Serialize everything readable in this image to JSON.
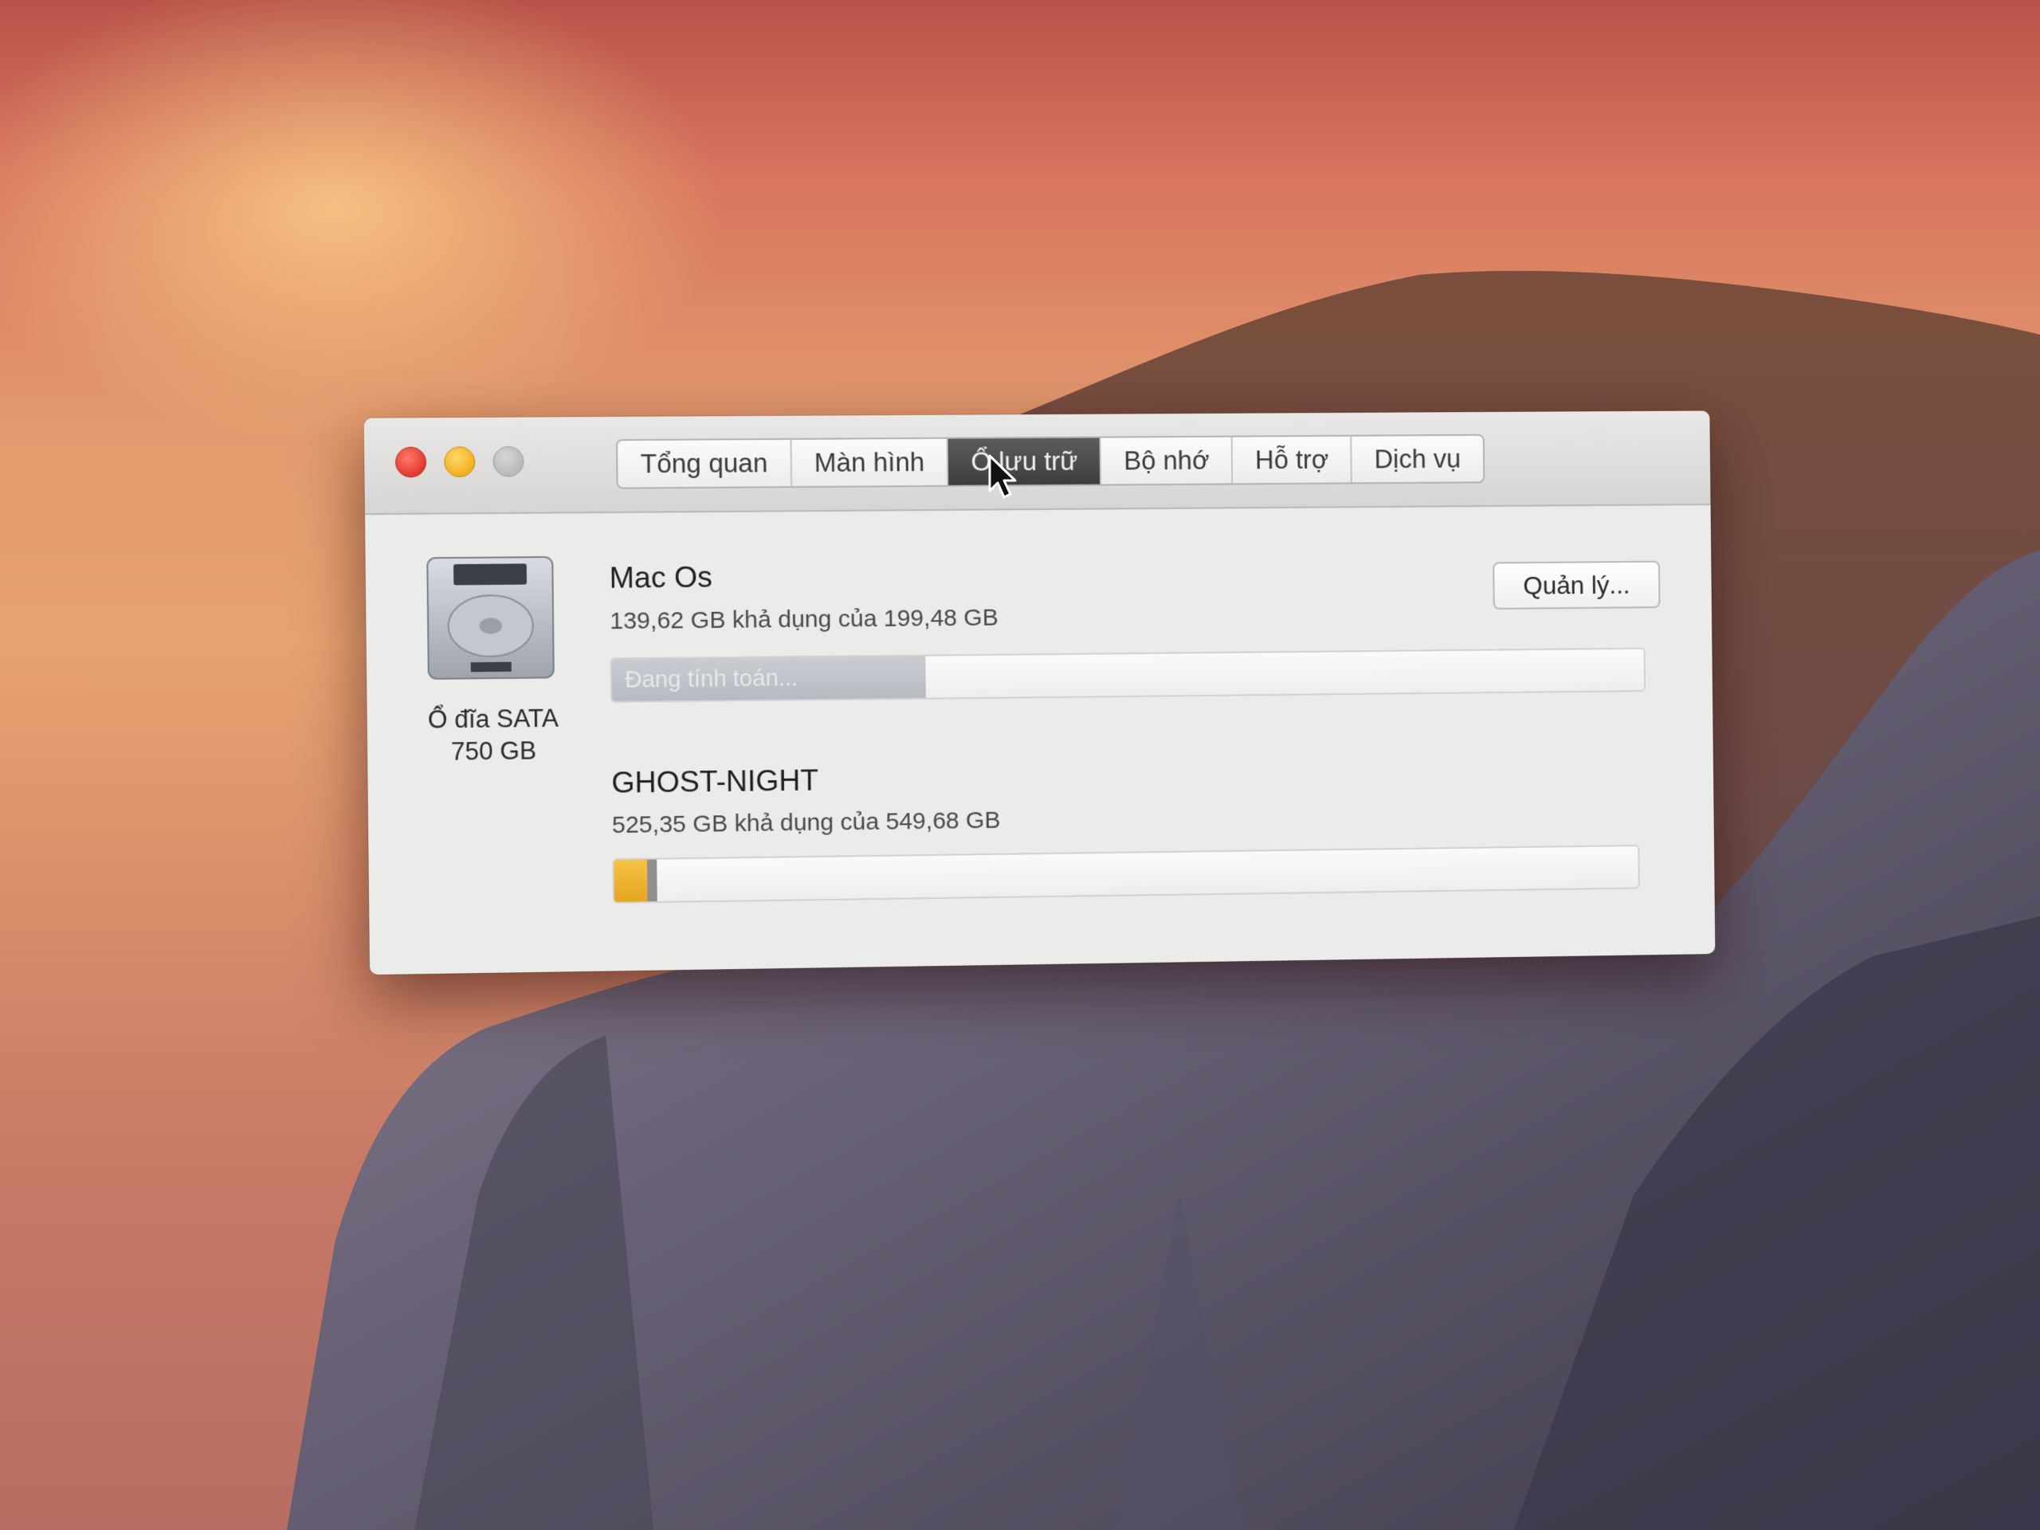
{
  "tabs": [
    {
      "label": "Tổng quan",
      "active": false
    },
    {
      "label": "Màn hình",
      "active": false
    },
    {
      "label": "Ổ lưu trữ",
      "active": true
    },
    {
      "label": "Bộ nhớ",
      "active": false
    },
    {
      "label": "Hỗ trợ",
      "active": false
    },
    {
      "label": "Dịch vụ",
      "active": false
    }
  ],
  "disk": {
    "icon": "hard-drive-icon",
    "label_line1": "Ổ đĩa SATA",
    "label_line2": "750 GB"
  },
  "volumes": [
    {
      "name": "Mac Os",
      "detail": "139,62 GB khả dụng của 199,48 GB",
      "bar_status": "Đang tính toán...",
      "calculating_fraction": 0.3
    },
    {
      "name": "GHOST-NIGHT",
      "detail": "525,35 GB khả dụng của 549,68 GB",
      "used_fraction_yellow": 0.032,
      "used_fraction_gray": 0.009
    }
  ],
  "buttons": {
    "manage": "Quản lý..."
  },
  "colors": {
    "active_tab": "#3d3d40",
    "close": "#e0392c",
    "minimize": "#f2b01f",
    "zoom": "#b9b9b9",
    "usage_yellow": "#e4a51e",
    "usage_gray": "#8f8f91"
  }
}
